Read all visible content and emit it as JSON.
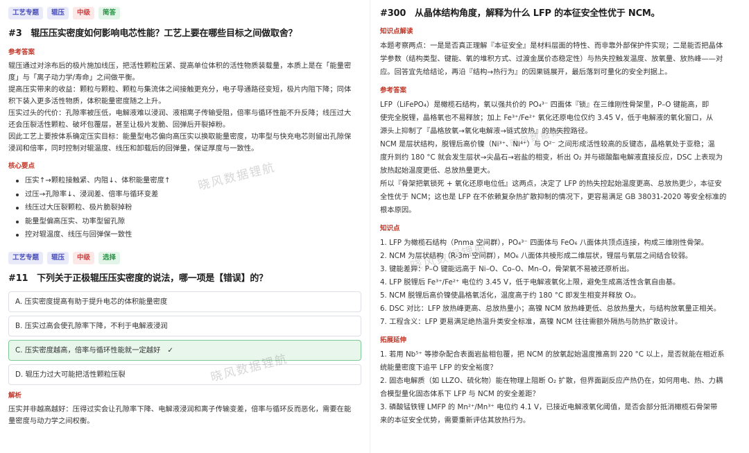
{
  "left": {
    "q3": {
      "tags": [
        "工艺专题",
        "辊压",
        "中级",
        "简答"
      ],
      "title": "#3　辊压压实密度如何影响电芯性能？工艺上要在哪些目标之间做取舍？",
      "ref_label": "参考答案",
      "ref_lines": [
        "辊压通过对涂布后的极片施加线压，把活性颗粒压紧、提高单位体积的活性物质装载量，本质上是在「能量密",
        "度」与「离子动力学/寿命」之间做平衡。",
        "提高压实带来的收益：颗粒与颗粒、颗粒与集流体之间接触更充分，电子导通路径变短，极片内阻下降；同体",
        "积下装入更多活性物质，体积能量密度随之上升。",
        "压实过头的代价：孔隙率被压低，电解液难以浸润、液相离子传输受阻，倍率与循环性能不升反降；线压过大",
        "还会压裂活性颗粒、破坏包覆层，甚至让极片发脆、回弹后开裂掉粉。",
        "因此工艺上要按体系确定压实目标：能量型电芯偏向高压实以换取能量密度，功率型与快充电芯则留出孔隙保",
        "浸润和倍率，同时控制对辊温度、线压和卸载后的回弹量，保证厚度与一致性。"
      ],
      "kp_label": "核心要点",
      "kp_items": [
        "压实↑→颗粒接触紧、内阻↓、体积能量密度↑",
        "过压→孔隙率↓、浸润差、倍率与循环变差",
        "线压过大压裂颗粒、极片脆裂掉粉",
        "能量型偏高压实、功率型留孔隙",
        "控对辊温度、线压与回弹保一致性"
      ]
    },
    "q11": {
      "tags": [
        "工艺专题",
        "辊压",
        "中级",
        "选择"
      ],
      "title": "#11　下列关于正极辊压压实密度的说法，哪一项是【错误】的？",
      "options": [
        "A. 压实密度提高有助于提升电芯的体积能量密度",
        "B. 压实过高会使孔隙率下降，不利于电解液浸润",
        "C. 压实密度越高，倍率与循环性能就一定越好",
        "D. 辊压力过大可能把活性颗粒压裂"
      ],
      "check": "✓",
      "analysis_label": "解析",
      "analysis_lines": [
        "压实并非越高越好：压得过实会让孔隙率下降、电解液浸润和离子传输变差，倍率与循环反而恶化，需要在能",
        "量密度与动力学之间权衡。"
      ]
    }
  },
  "right": {
    "title": "#300　从晶体结构角度，解释为什么 LFP 的本征安全性优于 NCM。",
    "intro_label": "知识点解读",
    "intro_lines": [
      "本题考察两点：一是是否真正理解『本征安全』是材料层面的特性、而非靠外部保护件实现；二是能否把晶体",
      "学参数（结构类型、键能、氧的堆积方式、过渡金属价态稳定性）与热失控触发温度、放氧量、放热峰——对",
      "应。回答宜先给结论，再沿『结构→热行为』的因果链展开，最后落到可量化的安全判据上。"
    ],
    "ref_label": "参考答案",
    "ref_lines": [
      "LFP（LiFePO₄）是橄榄石结构，氧以强共价的 PO₄³⁻ 四面体『锁』在三维刚性骨架里，P–O 键能高，即",
      "使完全脱锂，晶格氧也不易释放；加上 Fe³⁺/Fe²⁺ 氧化还原电位仅约 3.45 V，低于电解液的氧化窗口，从",
      "源头上抑制了『晶格放氧→氧化电解液→链式放热』的热失控路径。",
      "NCM 是层状结构，脱锂后高价镍（Ni³⁺、Ni⁴⁺）与 O²⁻ 之间形成活性较高的反键态，晶格氧处于亚稳；温",
      "度升到约 180 °C 就会发生层状→尖晶石→岩盐的相变，析出 O₂ 并与碳酸酯电解液直接反应，DSC 上表现为",
      "放热起始温度更低、总放热量更大。",
      "所以『骨架把氧锁死 + 氧化还原电位低』这两点，决定了 LFP 的热失控起始温度更高、总放热更少，本征安",
      "全性优于 NCM；这也是 LFP 在不依赖复杂热扩散抑制的情况下，更容易满足 GB 38031-2020 等安全标准的",
      "根本原因。"
    ],
    "kp_label": "知识点",
    "kp_lines": [
      "1. LFP 为橄榄石结构（Pnma 空间群），PO₄³⁻ 四面体与 FeO₆ 八面体共顶点连接，构成三维刚性骨架。",
      "2. NCM 为层状结构（R-3m 空间群），MO₆ 八面体共棱形成二维层状，锂层与氧层之间结合较弱。",
      "3. 键能差异：P–O 键能远高于 Ni–O、Co–O、Mn–O，骨架氧不易被还原析出。",
      "4. LFP 脱锂后 Fe³⁺/Fe²⁺ 电位约 3.45 V，低于电解液氧化上限，避免生成高活性含氧自由基。",
      "5. NCM 脱锂后高价镍使晶格氧活化，温度高于约 180 °C 即发生相变并释放 O₂。",
      "6. DSC 对比：LFP 放热峰更高、总放热量小；高镍 NCM 放热峰更低、总放热量大，与结构放氧量正相关。",
      "7. 工程含义：LFP 更易满足绝热温升类安全标准，高镍 NCM 往往需额外隔热与防热扩散设计。"
    ],
    "ext_label": "拓展延伸",
    "ext_lines": [
      "1. 若用 Nb⁵⁺ 等掺杂配合表面岩盐相包覆，把 NCM 的放氧起始温度推高到 220 °C 以上，是否就能在相近系",
      "统能量密度下追平 LFP 的安全裕度？",
      "2. 固态电解质（如 LLZO、硫化物）能在物理上阻断 O₂ 扩散，但界面副反应产热仍在，如何用电、热、力耦",
      "合模型量化固态体系下 LFP 与 NCM 的安全差距？",
      "3. 磷酸锰铁锂 LMFP 的 Mn²⁺/Mn³⁺ 电位约 4.1 V，已接近电解液氧化阈值，是否会部分抵消橄榄石骨架带",
      "来的本征安全优势，需要重新评估其放热行为。"
    ]
  },
  "watermark": "晓风数据锂航"
}
